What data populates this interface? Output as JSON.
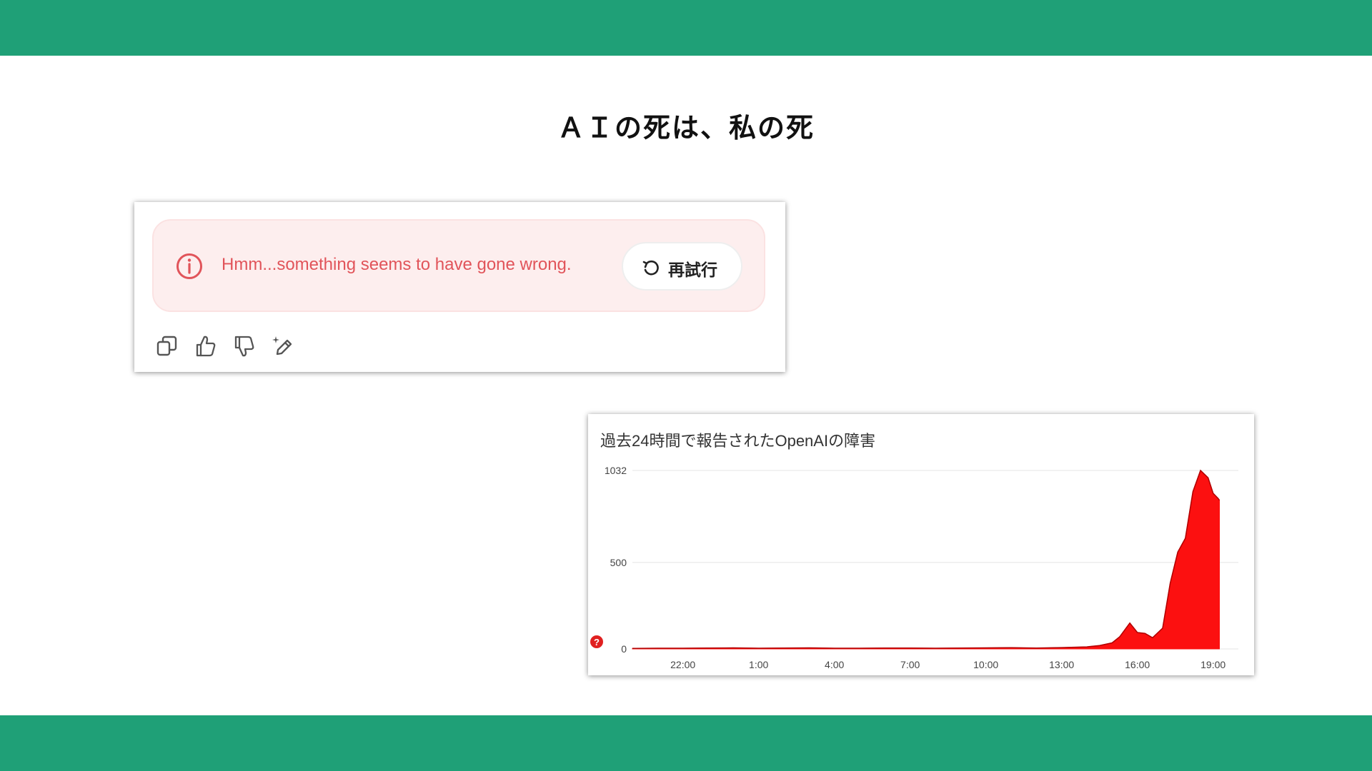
{
  "theme": {
    "band_color": "#1fa077",
    "error_red": "#e1545a",
    "chart_red": "#fc1010"
  },
  "slide": {
    "title": "ＡＩの死は、私の死"
  },
  "chatgpt_error": {
    "icon": "info-circle-icon",
    "message": "Hmm...something seems to have gone wrong.",
    "retry_icon": "retry-icon",
    "retry_label": "再試行",
    "actions": [
      {
        "name": "copy-icon"
      },
      {
        "name": "thumbs-up-icon"
      },
      {
        "name": "thumbs-down-icon"
      },
      {
        "name": "edit-sparkle-icon"
      }
    ]
  },
  "outage_chart": {
    "title": "過去24時間で報告されたOpenAIの障害",
    "alert_icon": "question-alert-icon",
    "alert_glyph": "?"
  },
  "chart_data": {
    "type": "area",
    "title": "過去24時間で報告されたOpenAIの障害",
    "xlabel": "",
    "ylabel": "",
    "ylim": [
      0,
      1032
    ],
    "y_ticks": [
      0,
      500,
      1032
    ],
    "x_range": [
      20.0,
      19.25
    ],
    "x_tick_labels": [
      "22:00",
      "1:00",
      "4:00",
      "7:00",
      "10:00",
      "13:00",
      "16:00",
      "19:00"
    ],
    "x_tick_hours_elapsed": [
      2,
      5,
      8,
      11,
      14,
      17,
      20,
      23
    ],
    "grid": true,
    "color": "#fc1010",
    "series": [
      {
        "x_hours_elapsed": [
          0,
          1,
          2,
          3,
          4,
          5,
          6,
          7,
          8,
          9,
          10,
          11,
          12,
          13,
          14,
          15,
          16,
          17,
          17.5,
          18,
          18.5,
          19,
          19.3,
          19.7,
          20,
          20.3,
          20.6,
          21.0,
          21.3,
          21.6,
          21.9,
          22.2,
          22.5,
          22.8,
          23.0,
          23.2,
          23.25
        ],
        "values": [
          3,
          4,
          4,
          5,
          6,
          4,
          5,
          6,
          4,
          4,
          5,
          5,
          4,
          5,
          6,
          7,
          5,
          8,
          10,
          12,
          20,
          35,
          70,
          150,
          95,
          90,
          65,
          120,
          380,
          560,
          640,
          910,
          1032,
          990,
          900,
          870,
          860
        ]
      }
    ]
  }
}
